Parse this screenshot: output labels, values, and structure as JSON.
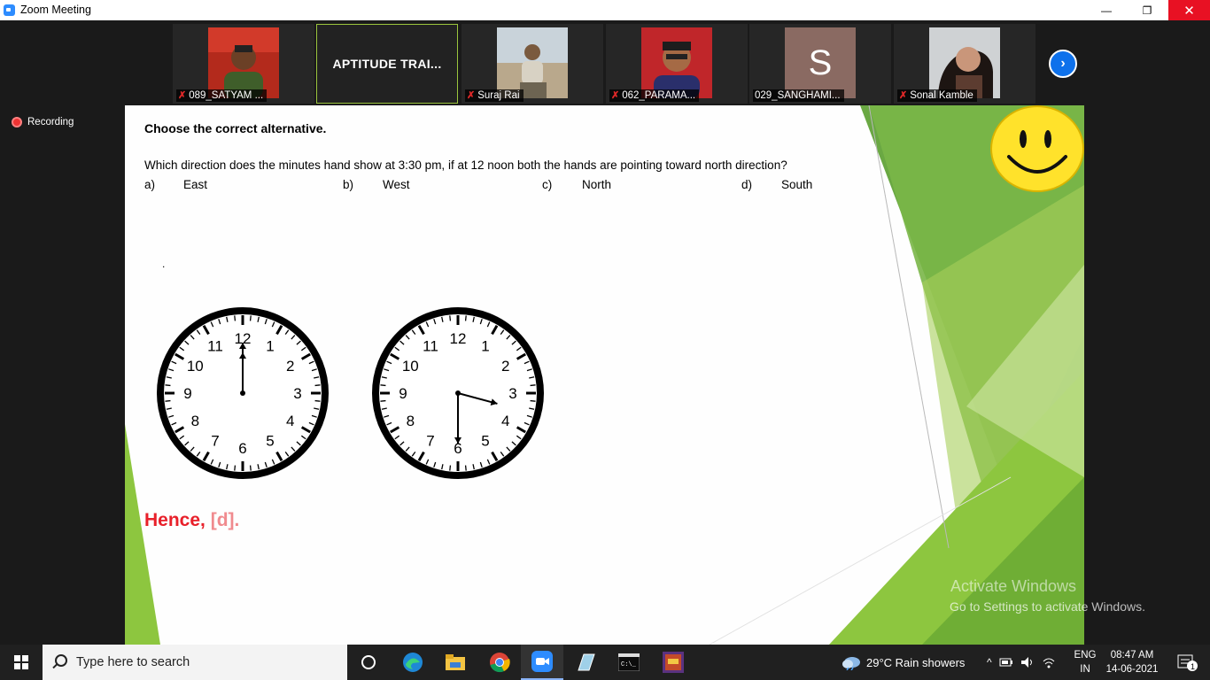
{
  "window": {
    "title": "Zoom Meeting",
    "minimize": "—",
    "maximize": "❐",
    "close": "✕"
  },
  "gallery": {
    "participants": [
      {
        "name": "089_SATYAM ...",
        "muted": true,
        "type": "video"
      },
      {
        "name": "APTITUDE TRAI...",
        "muted": false,
        "type": "name-only"
      },
      {
        "name": "Suraj Rai",
        "muted": true,
        "type": "video"
      },
      {
        "name": "062_PARAMA...",
        "muted": true,
        "type": "video"
      },
      {
        "name": "029_SANGHAMI...",
        "muted": false,
        "type": "avatar",
        "initial": "S",
        "avatar_color": "#8a6a62"
      },
      {
        "name": "Sonal Kamble",
        "muted": true,
        "type": "video"
      }
    ],
    "next_icon": "chevron-right-icon"
  },
  "recording": {
    "label": "Recording"
  },
  "slide": {
    "heading": "Choose the correct alternative.",
    "question": "Which direction does the minutes hand show at 3:30 pm, if at 12 noon both the hands are pointing toward north direction?",
    "options": [
      {
        "letter": "a)",
        "text": "East"
      },
      {
        "letter": "b)",
        "text": "West"
      },
      {
        "letter": "c)",
        "text": "North"
      },
      {
        "letter": "d)",
        "text": "South"
      }
    ],
    "dot": ".",
    "clock_numbers": [
      "12",
      "1",
      "2",
      "3",
      "4",
      "5",
      "6",
      "7",
      "8",
      "9",
      "10",
      "11"
    ],
    "clocks": [
      {
        "time": "12:00",
        "hour": 12,
        "minute": 0
      },
      {
        "time": "3:30",
        "hour": 3,
        "minute": 30
      }
    ],
    "answer_prefix": "Hence, ",
    "answer_value": "[d]",
    "answer_suffix": ".",
    "colors": {
      "answer_red": "#e8202a",
      "answer_pink": "#f08a8e",
      "green_dark": "#5a9e2f",
      "green_light": "#8dc63f"
    }
  },
  "watermark": {
    "line1": "Activate Windows",
    "line2": "Go to Settings to activate Windows."
  },
  "taskbar": {
    "search_placeholder": "Type here to search",
    "weather": "29°C  Rain showers",
    "language_1": "ENG",
    "language_2": "IN",
    "time": "08:47 AM",
    "date": "14-06-2021",
    "notification_count": "1",
    "pinned": [
      "task-view-icon",
      "edge-icon",
      "file-explorer-icon",
      "chrome-icon",
      "zoom-icon",
      "snip-icon",
      "terminal-icon",
      "game-icon"
    ]
  }
}
